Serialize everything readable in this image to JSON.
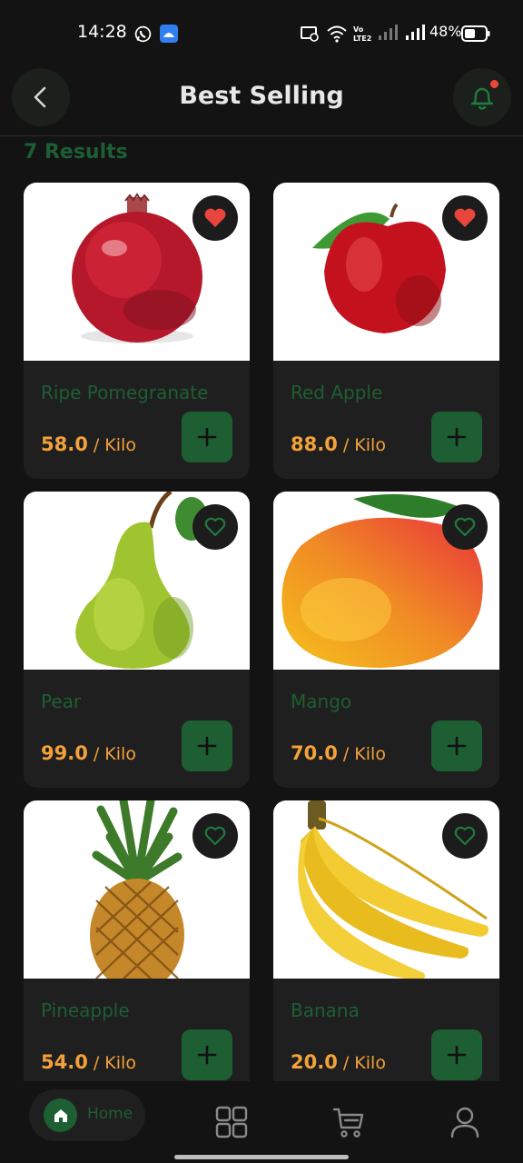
{
  "status_bar": {
    "time": "14:28",
    "battery": "48%",
    "icons": [
      "whatsapp-icon",
      "android-debug-icon",
      "cast-icon",
      "wifi-icon",
      "volte-icon",
      "signal-icon",
      "battery-icon"
    ]
  },
  "header": {
    "title": "Best Selling",
    "back_icon": "chevron-left-icon",
    "notification_icon": "bell-icon"
  },
  "results_label": "7 Results",
  "products": [
    {
      "name": "Ripe Pomegranate",
      "price": "58.0",
      "unit": " / Kilo",
      "favorite": true,
      "image": "pomegranate"
    },
    {
      "name": "Red Apple",
      "price": "88.0",
      "unit": " / Kilo",
      "favorite": true,
      "image": "apple"
    },
    {
      "name": "Pear",
      "price": "99.0",
      "unit": " / Kilo",
      "favorite": false,
      "image": "pear"
    },
    {
      "name": "Mango",
      "price": "70.0",
      "unit": " / Kilo",
      "favorite": false,
      "image": "mango"
    },
    {
      "name": "Pineapple",
      "price": "54.0",
      "unit": " / Kilo",
      "favorite": false,
      "image": "pineapple"
    },
    {
      "name": "Banana",
      "price": "20.0",
      "unit": " / Kilo",
      "favorite": false,
      "image": "banana"
    }
  ],
  "bottom_nav": {
    "home_label": "Home",
    "items": [
      "home-icon",
      "grid-icon",
      "cart-icon",
      "profile-icon"
    ]
  },
  "colors": {
    "accent_green": "#1e5e33",
    "price_orange": "#f3a13b",
    "favorite_red": "#e8453c",
    "background": "#131313",
    "card": "#1f1f1f"
  }
}
